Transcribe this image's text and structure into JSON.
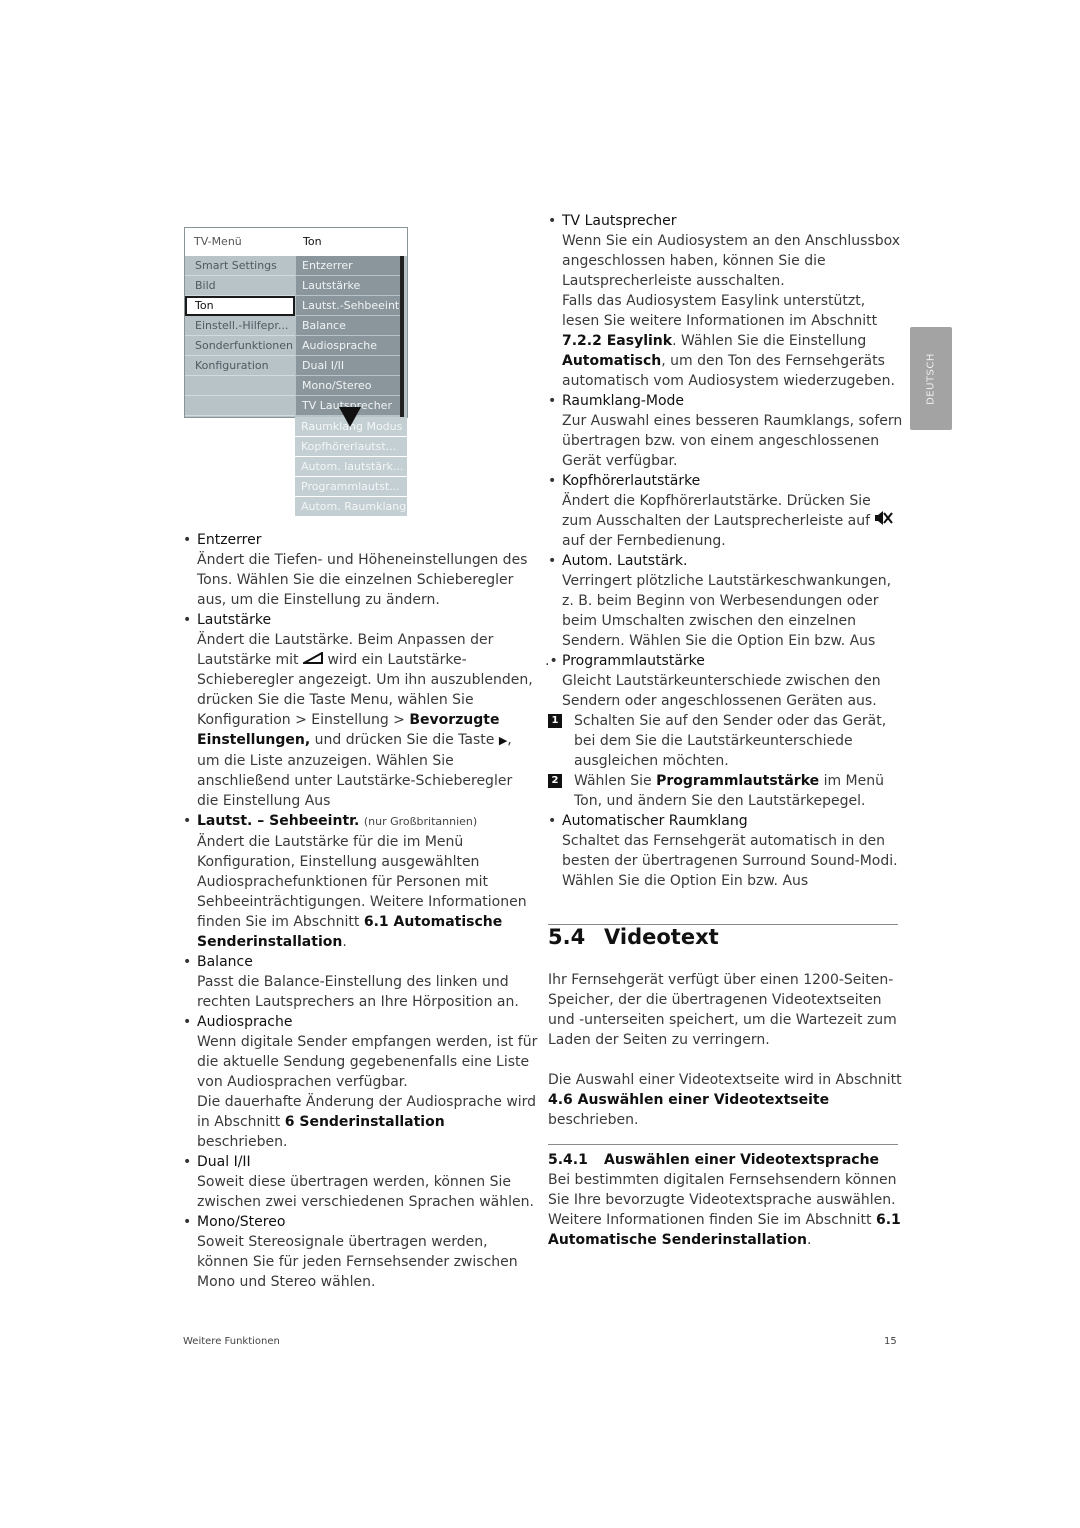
{
  "tv_menu": {
    "header_left": "TV-Menü",
    "header_right": "Ton",
    "left_items": [
      "Smart Settings",
      "Bild",
      "Ton",
      "Einstell.-Hilfepr...",
      "Sonderfunktionen",
      "Konfiguration",
      "",
      ""
    ],
    "selected_left": "Ton",
    "right_items": [
      "Entzerrer",
      "Lautstärke",
      "Lautst.-Sehbeeintr.",
      "Balance",
      "Audiosprache",
      "Dual I/II",
      "Mono/Stereo",
      "TV Lautsprecher"
    ],
    "extra_items": [
      "Raumklang Modus",
      "Kopfhörerlautst...",
      "Autom. lautstärk...",
      "Programmlautst...",
      "Autom. Raumklang"
    ]
  },
  "left_column": {
    "entzerrer": {
      "title": "Entzerrer",
      "body": "Ändert die Tiefen- und Höheneinstellungen des Tons. Wählen Sie die einzelnen Schieberegler aus, um die Einstellung zu ändern."
    },
    "lautstaerke": {
      "title": "Lautstärke",
      "body_1": "Ändert die Lautstärke. Beim Anpassen der Lautstärke mit",
      "body_2": "wird ein Lautstärke-Schieberegler angezeigt. Um ihn auszublenden, drücken Sie die Taste Menu, wählen Sie Konfiguration > Einstellung >",
      "bold_1": "Bevorzugte Einstellungen,",
      "body_3": "und drücken Sie die Taste",
      "body_4": ", um die Liste anzuzeigen. Wählen Sie anschließend unter Lautstärke-Schieberegler die Einstellung Aus"
    },
    "sehbeeintr": {
      "title": "Lautst. – Sehbeeintr.",
      "note": "(nur Großbritannien)",
      "body_1": "Ändert die Lautstärke für die im Menü Konfiguration, Einstellung ausgewählten Audiosprachefunktionen für Personen mit Sehbeeinträchtigungen. Weitere Informationen finden Sie im Abschnitt",
      "bold_1": "6.1 Automatische Senderinstallation",
      "body_2": "."
    },
    "balance": {
      "title": "Balance",
      "body": "Passt die Balance-Einstellung des linken und rechten Lautsprechers an Ihre Hörposition an."
    },
    "audiosprache": {
      "title": "Audiosprache",
      "body_1": "Wenn digitale Sender empfangen werden, ist für die aktuelle Sendung gegebenenfalls eine Liste von Audiosprachen verfügbar.",
      "body_2": "Die dauerhafte Änderung der Audiosprache wird in Abschnitt",
      "bold_1": "6 Senderinstallation",
      "body_3": "beschrieben."
    },
    "dual": {
      "title": "Dual I/II",
      "body": "Soweit diese übertragen werden, können Sie zwischen zwei verschiedenen Sprachen wählen."
    },
    "mono": {
      "title": "Mono/Stereo",
      "body": "Soweit Stereosignale übertragen werden, können Sie für jeden Fernsehsender zwischen Mono und Stereo wählen."
    }
  },
  "right_column": {
    "tv_lautsprecher": {
      "title": "TV Lautsprecher",
      "body_1": "Wenn Sie ein Audiosystem an den Anschlussbox angeschlossen haben, können Sie die Lautsprecherleiste ausschalten.",
      "body_2": "Falls das Audiosystem Easylink unterstützt, lesen Sie weitere Informationen im Abschnitt",
      "bold_1": "7.2.2 Easylink",
      "body_3": ". Wählen Sie die Einstellung",
      "bold_2": "Automatisch",
      "body_4": ", um den Ton des Fernsehgeräts automatisch vom Audiosystem wiederzugeben."
    },
    "raumklang": {
      "title": "Raumklang-Mode",
      "body": "Zur Auswahl eines besseren Raumklangs, sofern übertragen bzw. von einem angeschlossenen Gerät verfügbar."
    },
    "kopfhoerer": {
      "title": "Kopfhörerlautstärke",
      "body_1": "Ändert die Kopfhörerlautstärke. Drücken Sie zum Ausschalten der Lautsprecherleiste auf",
      "body_2": "auf der Fernbedienung."
    },
    "autom_lautstaerk": {
      "title": "Autom. Lautstärk.",
      "body": "Verringert plötzliche Lautstärkeschwankungen, z. B. beim Beginn von Werbesendungen oder beim Umschalten zwischen den einzelnen Sendern. Wählen Sie die Option Ein bzw. Aus"
    },
    "programm": {
      "title": "Programmlautstärke",
      "bullet": ".•",
      "body": "Gleicht Lautstärkeunterschiede zwischen den Sendern oder angeschlossenen Geräten aus.",
      "steps": [
        {
          "num": "1",
          "text": "Schalten Sie auf den Sender oder das Gerät, bei dem Sie die Lautstärkeunterschiede ausgleichen möchten."
        },
        {
          "num": "2",
          "pre": "Wählen Sie",
          "bold": "Programmlautstärke",
          "post": "im Menü Ton, und ändern Sie den Lautstärkepegel."
        }
      ]
    },
    "auto_raumklang": {
      "title": "Automatischer Raumklang",
      "body": "Schaltet das Fernsehgerät automatisch in den besten der übertragenen Surround Sound-Modi. Wählen Sie die Option Ein bzw. Aus"
    }
  },
  "section": {
    "number": "5.4",
    "title": "Videotext",
    "para_1": "Ihr Fernsehgerät verfügt über einen 1200-Seiten-Speicher, der die übertragenen Videotextseiten und -unterseiten speichert, um die Wartezeit zum Laden der Seiten zu verringern.",
    "para_2_pre": "Die Auswahl einer Videotextseite wird in Abschnitt",
    "para_2_bold": "4.6 Auswählen einer Videotextseite",
    "para_2_post": "beschrieben.",
    "sub": {
      "number": "5.4.1",
      "title": "Auswählen einer Videotextsprache",
      "body_1": "Bei bestimmten digitalen Fernsehsendern können Sie Ihre bevorzugte Videotextsprache auswählen. Weitere Informationen finden Sie im Abschnitt",
      "bold_1": "6.1 Automatische Senderinstallation",
      "body_2": "."
    }
  },
  "lang_tab": "DEUTSCH",
  "footer": {
    "left": "Weitere Funktionen",
    "page_number": "15"
  },
  "icons": {
    "bullet": "•",
    "volume": "volume-icon",
    "right_arrow": "▶",
    "mute": "mute-icon"
  }
}
